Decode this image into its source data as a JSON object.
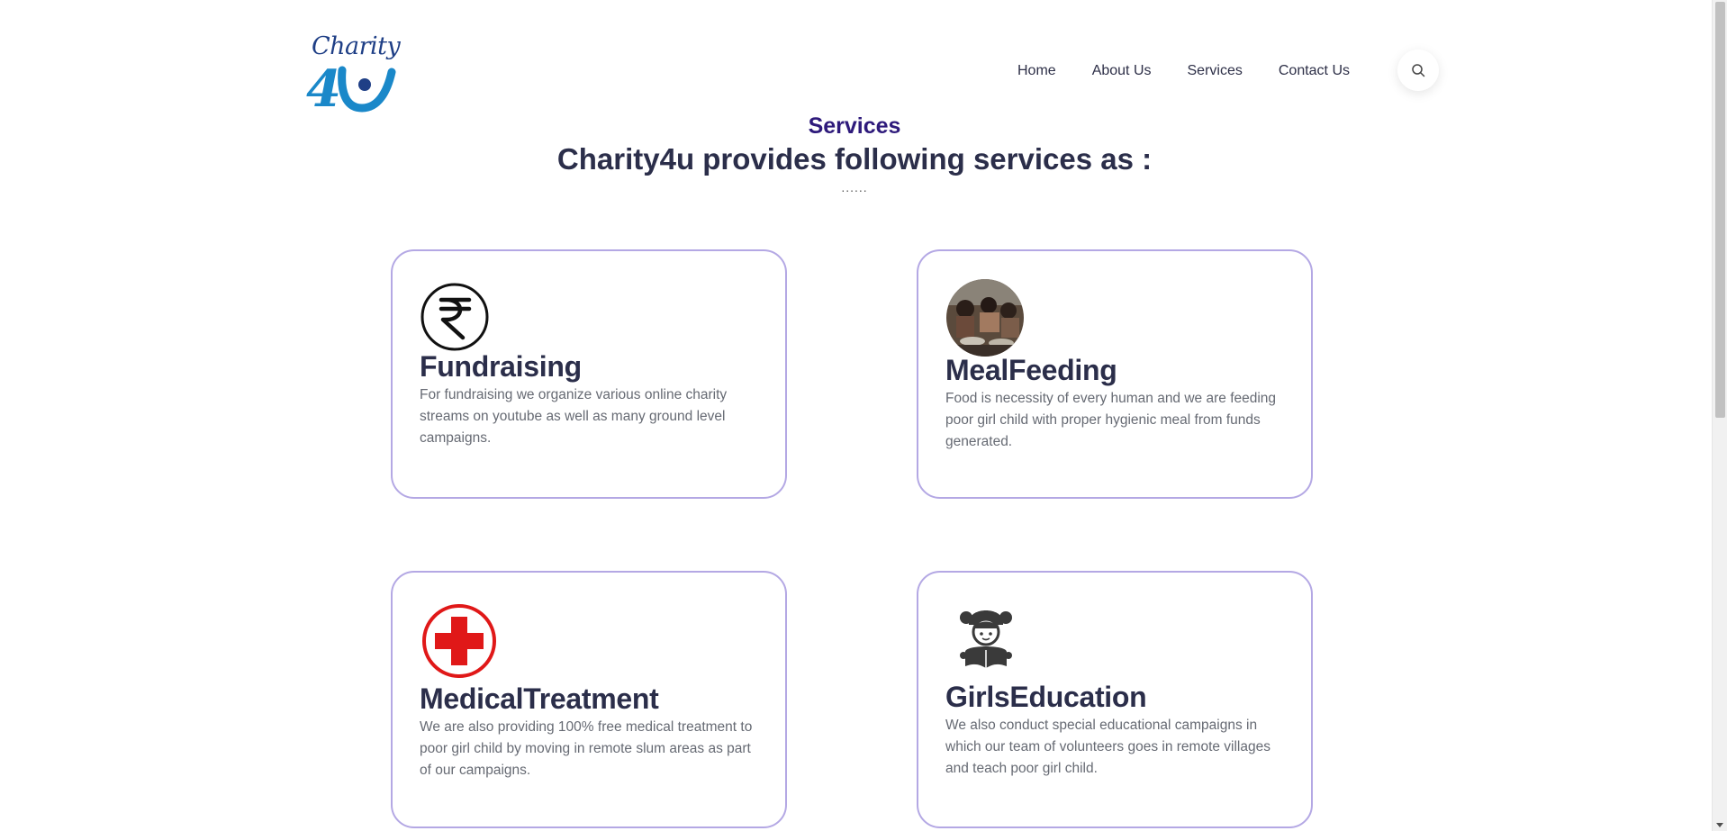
{
  "logo": {
    "script_text": "Charity",
    "mark_text": "4u"
  },
  "nav": {
    "items": [
      {
        "label": "Home"
      },
      {
        "label": "About Us"
      },
      {
        "label": "Services"
      },
      {
        "label": "Contact Us"
      }
    ],
    "search_icon": "search-icon"
  },
  "section": {
    "label": "Services",
    "title": "Charity4u provides following services as :",
    "dots": "......"
  },
  "cards": [
    {
      "icon": "rupee-icon",
      "title": "Fundraising",
      "text": "For fundraising we organize various online charity streams on youtube as well as many ground level campaigns."
    },
    {
      "icon": "children-eating-photo",
      "title": "MealFeeding",
      "text": "Food is necessity of every human and we are feeding poor girl child with proper hygienic meal from funds generated."
    },
    {
      "icon": "medical-cross-icon",
      "title": "MedicalTreatment",
      "text": "We are also providing 100% free medical treatment to poor girl child by moving in remote slum areas as part of our campaigns."
    },
    {
      "icon": "girl-reading-icon",
      "title": "GirlsEducation",
      "text": "We also conduct special educational campaigns in which our team of volunteers goes in remote villages and teach poor girl child."
    }
  ],
  "colors": {
    "accent": "#2e1a7b",
    "heading": "#2b2e4a",
    "card_border": "#b4a8e4",
    "logo_blue": "#1a88c9",
    "medical_red": "#e01818"
  }
}
